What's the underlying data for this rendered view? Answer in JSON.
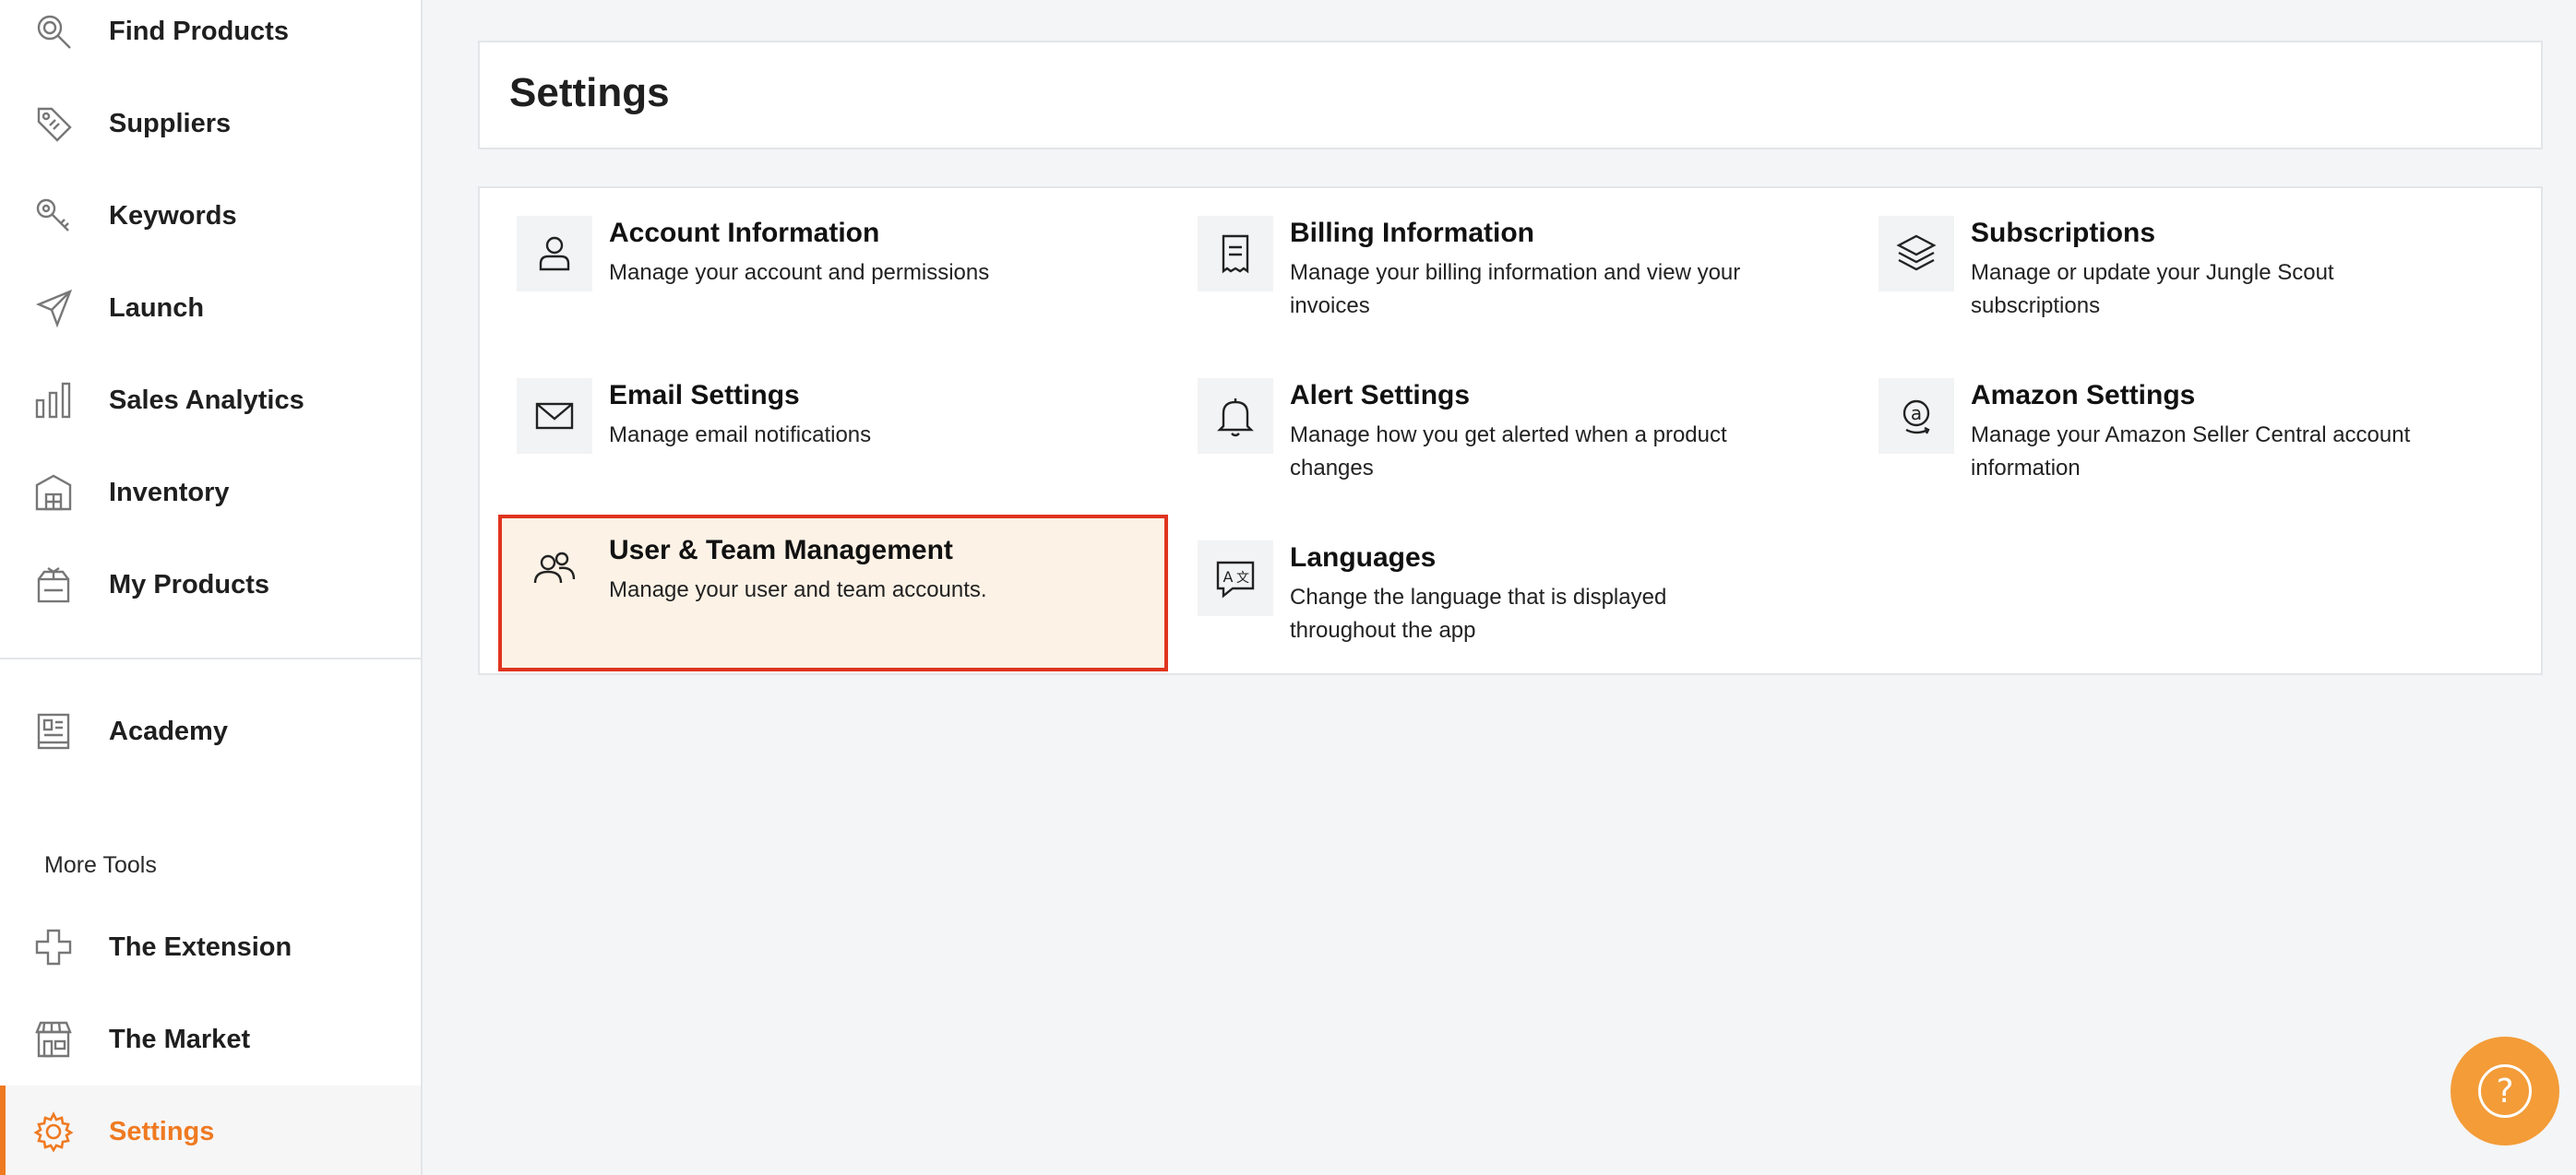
{
  "sidebar": {
    "items": [
      {
        "label": "Find Products",
        "icon": "search-icon"
      },
      {
        "label": "Suppliers",
        "icon": "tag-icon"
      },
      {
        "label": "Keywords",
        "icon": "key-icon"
      },
      {
        "label": "Launch",
        "icon": "paper-plane-icon"
      },
      {
        "label": "Sales Analytics",
        "icon": "bar-chart-icon"
      },
      {
        "label": "Inventory",
        "icon": "warehouse-icon"
      },
      {
        "label": "My Products",
        "icon": "box-icon"
      }
    ],
    "academy": {
      "label": "Academy",
      "icon": "book-icon"
    },
    "more_tools_label": "More Tools",
    "tools": [
      {
        "label": "The Extension",
        "icon": "puzzle-icon"
      },
      {
        "label": "The Market",
        "icon": "storefront-icon"
      },
      {
        "label": "Settings",
        "icon": "gear-icon",
        "active": true
      }
    ]
  },
  "header": {
    "title": "Settings"
  },
  "settings": [
    {
      "title": "Account Information",
      "desc": "Manage your account and permissions",
      "icon": "user-icon"
    },
    {
      "title": "Billing Information",
      "desc": "Manage your billing information and view your invoices",
      "icon": "receipt-icon"
    },
    {
      "title": "Subscriptions",
      "desc": "Manage or update your Jungle Scout subscriptions",
      "icon": "layers-icon"
    },
    {
      "title": "Email Settings",
      "desc": "Manage email notifications",
      "icon": "envelope-icon"
    },
    {
      "title": "Alert Settings",
      "desc": "Manage how you get alerted when a product changes",
      "icon": "bell-icon"
    },
    {
      "title": "Amazon Settings",
      "desc": "Manage your Amazon Seller Central account information",
      "icon": "amazon-icon"
    },
    {
      "title": "User & Team Management",
      "desc": "Manage your user and team accounts.",
      "icon": "users-icon",
      "highlighted": true
    },
    {
      "title": "Languages",
      "desc": "Change the language that is displayed throughout the app",
      "icon": "translate-icon"
    }
  ],
  "help": {
    "label": "?"
  },
  "colors": {
    "accent": "#ef7a21",
    "highlight_border": "#e0341f",
    "highlight_bg": "#fdf2e6",
    "help_button": "#f39c38"
  }
}
